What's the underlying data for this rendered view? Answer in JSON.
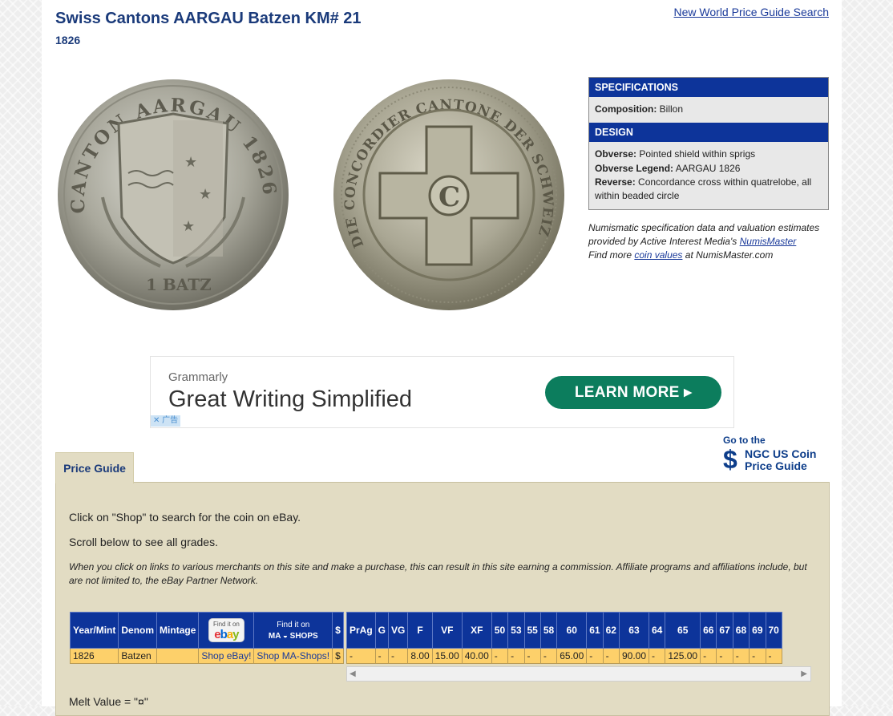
{
  "page": {
    "title": "Swiss Cantons AARGAU Batzen KM# 21",
    "subtitle": "1826",
    "search_link": "New World Price Guide Search"
  },
  "coin": {
    "obverse_legend_top": "CANTON AARGAU 1826",
    "obverse_legend_bottom": "1 BATZ",
    "reverse_legend": "DIE CONCORDIER CANTONE DER SCHWEIZ",
    "reverse_center": "C"
  },
  "specs": {
    "header": "SPECIFICATIONS",
    "composition_label": "Composition:",
    "composition_value": "Billon",
    "design_header": "DESIGN",
    "obverse_label": "Obverse:",
    "obverse_value": "Pointed shield within sprigs",
    "obverse_legend_label": "Obverse Legend:",
    "obverse_legend_value": "AARGAU 1826",
    "reverse_label": "Reverse:",
    "reverse_value": "Concordance cross within quatrelobe, all within beaded circle"
  },
  "credit": {
    "line1": "Numismatic specification data and valuation estimates provided by Active Interest Media's",
    "link1": "NumisMaster",
    "line2_pre": "Find more",
    "link2": "coin values",
    "line2_post": "at NumisMaster.com"
  },
  "ad": {
    "brand": "Grammarly",
    "headline": "Great Writing Simplified",
    "cta": "LEARN MORE",
    "adchoice": "广告"
  },
  "ngc": {
    "goto": "Go to the",
    "symbol": "$",
    "line1": "NGC US Coin",
    "line2": "Price Guide"
  },
  "tab": "Price Guide",
  "guide": {
    "p1": "Click on \"Shop\" to search for the coin on eBay.",
    "p2": "Scroll below to see all grades.",
    "p3": "When you click on links to various merchants on this site and make a purchase, this can result in this site earning a commission. Affiliate programs and affiliations include, but are not limited to, the eBay Partner Network.",
    "melt": "Melt Value = \"¤\""
  },
  "table": {
    "left_headers": [
      "Year/Mint",
      "Denom",
      "Mintage"
    ],
    "ebay_header": {
      "find": "Find it on",
      "logo": [
        "e",
        "b",
        "a",
        "y"
      ]
    },
    "ma_header": {
      "find": "Find it on",
      "logo": "MA ◒ SHOPS"
    },
    "dollar_header": "$",
    "grade_headers": [
      "PrAg",
      "G",
      "VG",
      "F",
      "VF",
      "XF",
      "50",
      "53",
      "55",
      "58",
      "60",
      "61",
      "62",
      "63",
      "64",
      "65",
      "66",
      "67",
      "68",
      "69",
      "70"
    ],
    "row": {
      "year": "1826",
      "denom": "Batzen",
      "mintage": "",
      "ebay": "Shop eBay!",
      "ma": "Shop MA-Shops!",
      "dollar": "$",
      "values": [
        "-",
        "-",
        "-",
        "8.00",
        "15.00",
        "40.00",
        "-",
        "-",
        "-",
        "-",
        "65.00",
        "-",
        "-",
        "90.00",
        "-",
        "125.00",
        "-",
        "-",
        "-",
        "-",
        "-"
      ]
    }
  },
  "colors": {
    "navy": "#0d349a",
    "tan": "#e2dcc3",
    "gold_row": "#fdd06a",
    "cta_green": "#0c7d5d"
  }
}
